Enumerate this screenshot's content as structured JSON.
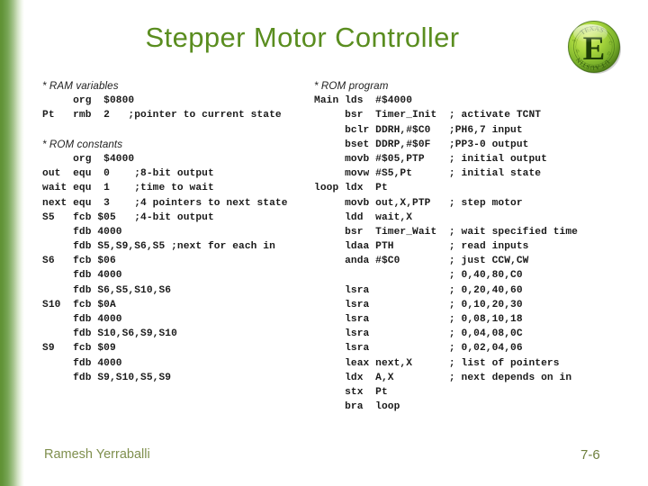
{
  "slide": {
    "title": "Stepper Motor Controller",
    "title_color": "#5a8d1f",
    "background_color": "#ffffff",
    "accent_color": "#5f9133"
  },
  "logo": {
    "name": "embedded-systems-seal-logo",
    "letter": "E",
    "color_light": "#b6dd4a",
    "color_dark": "#5f9133",
    "ring_text_top": "TExAS",
    "ring_text_bottom": "UT"
  },
  "code_left": {
    "lines": [
      {
        "type": "section",
        "text": "* RAM variables"
      },
      {
        "type": "code",
        "text": "     org  $0800"
      },
      {
        "type": "code",
        "text": "Pt   rmb  2   ;pointer to current state"
      },
      {
        "type": "blank",
        "text": ""
      },
      {
        "type": "section",
        "text": "* ROM constants"
      },
      {
        "type": "code",
        "text": "     org  $4000"
      },
      {
        "type": "code",
        "text": "out  equ  0    ;8-bit output"
      },
      {
        "type": "code",
        "text": "wait equ  1    ;time to wait"
      },
      {
        "type": "code",
        "text": "next equ  3    ;4 pointers to next state"
      },
      {
        "type": "code",
        "text": "S5   fcb $05   ;4-bit output"
      },
      {
        "type": "code",
        "text": "     fdb 4000"
      },
      {
        "type": "code",
        "text": "     fdb S5,S9,S6,S5 ;next for each in"
      },
      {
        "type": "code",
        "text": "S6   fcb $06"
      },
      {
        "type": "code",
        "text": "     fdb 4000"
      },
      {
        "type": "code",
        "text": "     fdb S6,S5,S10,S6"
      },
      {
        "type": "code",
        "text": "S10  fcb $0A"
      },
      {
        "type": "code",
        "text": "     fdb 4000"
      },
      {
        "type": "code",
        "text": "     fdb S10,S6,S9,S10"
      },
      {
        "type": "code",
        "text": "S9   fcb $09"
      },
      {
        "type": "code",
        "text": "     fdb 4000"
      },
      {
        "type": "code",
        "text": "     fdb S9,S10,S5,S9"
      }
    ]
  },
  "code_right": {
    "lines": [
      {
        "type": "section",
        "text": "* ROM program"
      },
      {
        "type": "code",
        "text": "Main lds  #$4000"
      },
      {
        "type": "code",
        "text": "     bsr  Timer_Init  ; activate TCNT"
      },
      {
        "type": "code",
        "text": "     bclr DDRH,#$C0   ;PH6,7 input"
      },
      {
        "type": "code",
        "text": "     bset DDRP,#$0F   ;PP3-0 output"
      },
      {
        "type": "code",
        "text": "     movb #$05,PTP    ; initial output"
      },
      {
        "type": "code",
        "text": "     movw #S5,Pt      ; initial state"
      },
      {
        "type": "code",
        "text": "loop ldx  Pt"
      },
      {
        "type": "code",
        "text": "     movb out,X,PTP   ; step motor"
      },
      {
        "type": "code",
        "text": "     ldd  wait,X"
      },
      {
        "type": "code",
        "text": "     bsr  Timer_Wait  ; wait specified time"
      },
      {
        "type": "code",
        "text": "     ldaa PTH         ; read inputs"
      },
      {
        "type": "code",
        "text": "     anda #$C0        ; just CCW,CW"
      },
      {
        "type": "code",
        "text": "                      ; 0,40,80,C0"
      },
      {
        "type": "code",
        "text": "     lsra             ; 0,20,40,60"
      },
      {
        "type": "code",
        "text": "     lsra             ; 0,10,20,30"
      },
      {
        "type": "code",
        "text": "     lsra             ; 0,08,10,18"
      },
      {
        "type": "code",
        "text": "     lsra             ; 0,04,08,0C"
      },
      {
        "type": "code",
        "text": "     lsra             ; 0,02,04,06"
      },
      {
        "type": "code",
        "text": "     leax next,X      ; list of pointers"
      },
      {
        "type": "code",
        "text": "     ldx  A,X         ; next depends on in"
      },
      {
        "type": "code",
        "text": "     stx  Pt"
      },
      {
        "type": "code",
        "text": "     bra  loop"
      }
    ]
  },
  "footer": {
    "author": "Ramesh Yerraballi",
    "page": "7-6"
  }
}
